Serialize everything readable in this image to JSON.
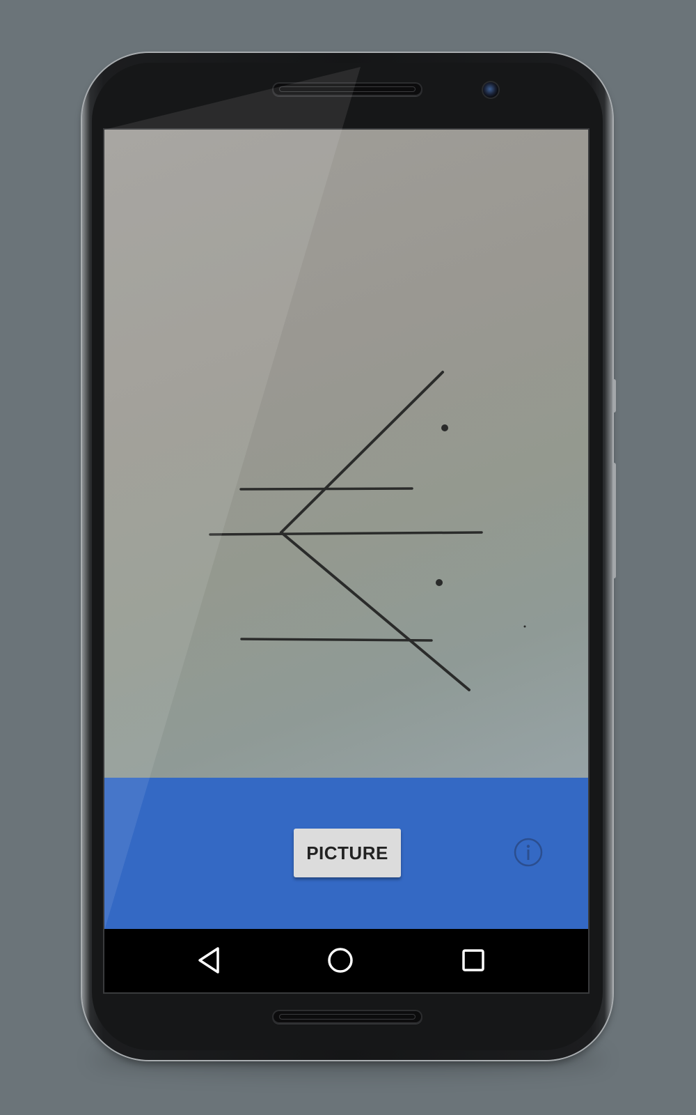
{
  "app": {
    "capture_button_label": "PICTURE",
    "accent_color": "#3469c4",
    "background_color": "#6b7479"
  },
  "icons": {
    "info": "info-circle-icon",
    "back": "nav-back-triangle-icon",
    "home": "nav-home-circle-icon",
    "recents": "nav-recents-square-icon"
  }
}
